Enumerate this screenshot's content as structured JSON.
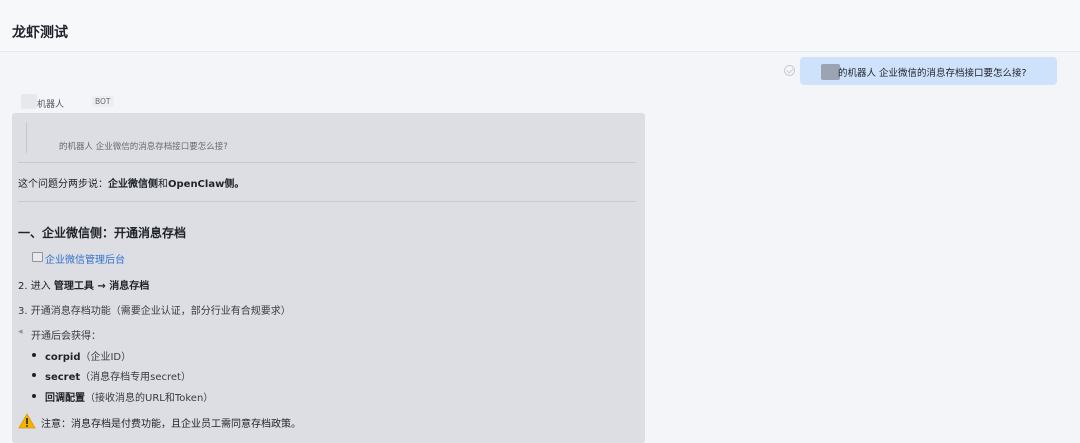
{
  "header": {
    "title": "龙虾测试"
  },
  "user_message": {
    "text": "的机器人 企业微信的消息存档接口要怎么接?"
  },
  "sender": {
    "name": "机器人",
    "badge": "BOT"
  },
  "reply": {
    "quote": "的机器人 企业微信的消息存档接口要怎么接?",
    "intro_prefix": "这个问题分两步说：",
    "intro_part1": "企业微信侧",
    "intro_and": "和",
    "intro_part2": "OpenClaw侧",
    "intro_end": "。",
    "section1_title": "一、企业微信侧：开通消息存档",
    "step1_link": "企业微信管理后台",
    "step2_prefix": "2. 进入 ",
    "step2_bold": "管理工具 → 消息存档",
    "step3": "3. 开通消息存档功能（需要企业认证，部分行业有合规要求）",
    "step4": "开通后会获得：",
    "bullets": [
      {
        "bold": "corpid",
        "rest": "（企业ID）"
      },
      {
        "bold": "secret",
        "rest": "（消息存档专用secret）"
      },
      {
        "bold": "回调配置",
        "rest": "（接收消息的URL和Token）"
      }
    ],
    "warning": "注意：消息存档是付费功能，且企业员工需同意存档政策。"
  }
}
